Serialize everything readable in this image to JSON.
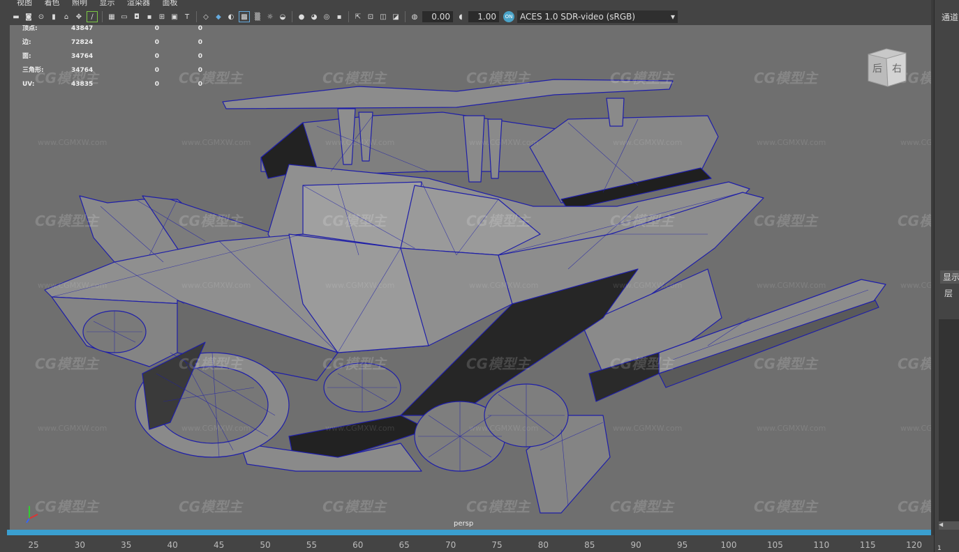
{
  "menu": {
    "items": [
      "视图",
      "着色",
      "照明",
      "显示",
      "渲染器",
      "面板"
    ]
  },
  "toolbar": {
    "exposure": "0.00",
    "gamma": "1.00",
    "color_management_badge": "ON",
    "colorspace": "ACES 1.0 SDR-video (sRGB)",
    "icons": [
      "camera-icon",
      "camera-attrs-icon",
      "bookmark-icon",
      "image-plane-icon",
      "grid-icon",
      "film-gate-icon",
      "resolution-gate-icon",
      "safe-action-icon",
      "wireframe-icon",
      "smooth-shade-icon",
      "textured-icon",
      "lights-icon",
      "shadows-icon",
      "isolate-icon",
      "xray-icon"
    ]
  },
  "hud": {
    "rows": [
      {
        "label": "顶点:",
        "v1": "43847",
        "v2": "0",
        "v3": "0"
      },
      {
        "label": "边:",
        "v1": "72824",
        "v2": "0",
        "v3": "0"
      },
      {
        "label": "面:",
        "v1": "34764",
        "v2": "0",
        "v3": "0"
      },
      {
        "label": "三角形:",
        "v1": "34764",
        "v2": "0",
        "v3": "0"
      },
      {
        "label": "UV:",
        "v1": "43835",
        "v2": "0",
        "v3": "0"
      }
    ]
  },
  "viewport": {
    "camera": "persp",
    "watermark_logo": "CG模型主",
    "watermark_url": "www.CGMXW.com",
    "viewcube_labels": [
      "后",
      "右"
    ],
    "colors": {
      "background": "#6f6f6f",
      "wireframe": "#1e1ea8",
      "shade_light": "#8a8a8a",
      "shade_dark": "#2a2a2a"
    }
  },
  "timeline": {
    "ticks": [
      "25",
      "30",
      "35",
      "40",
      "45",
      "50",
      "55",
      "60",
      "65",
      "70",
      "75",
      "80",
      "85",
      "90",
      "95",
      "100",
      "105",
      "110",
      "115",
      "120"
    ]
  },
  "right_panel": {
    "channel_tab": "通道",
    "display_tab": "显示",
    "layer_tab": "层",
    "bottom_num": "1"
  }
}
